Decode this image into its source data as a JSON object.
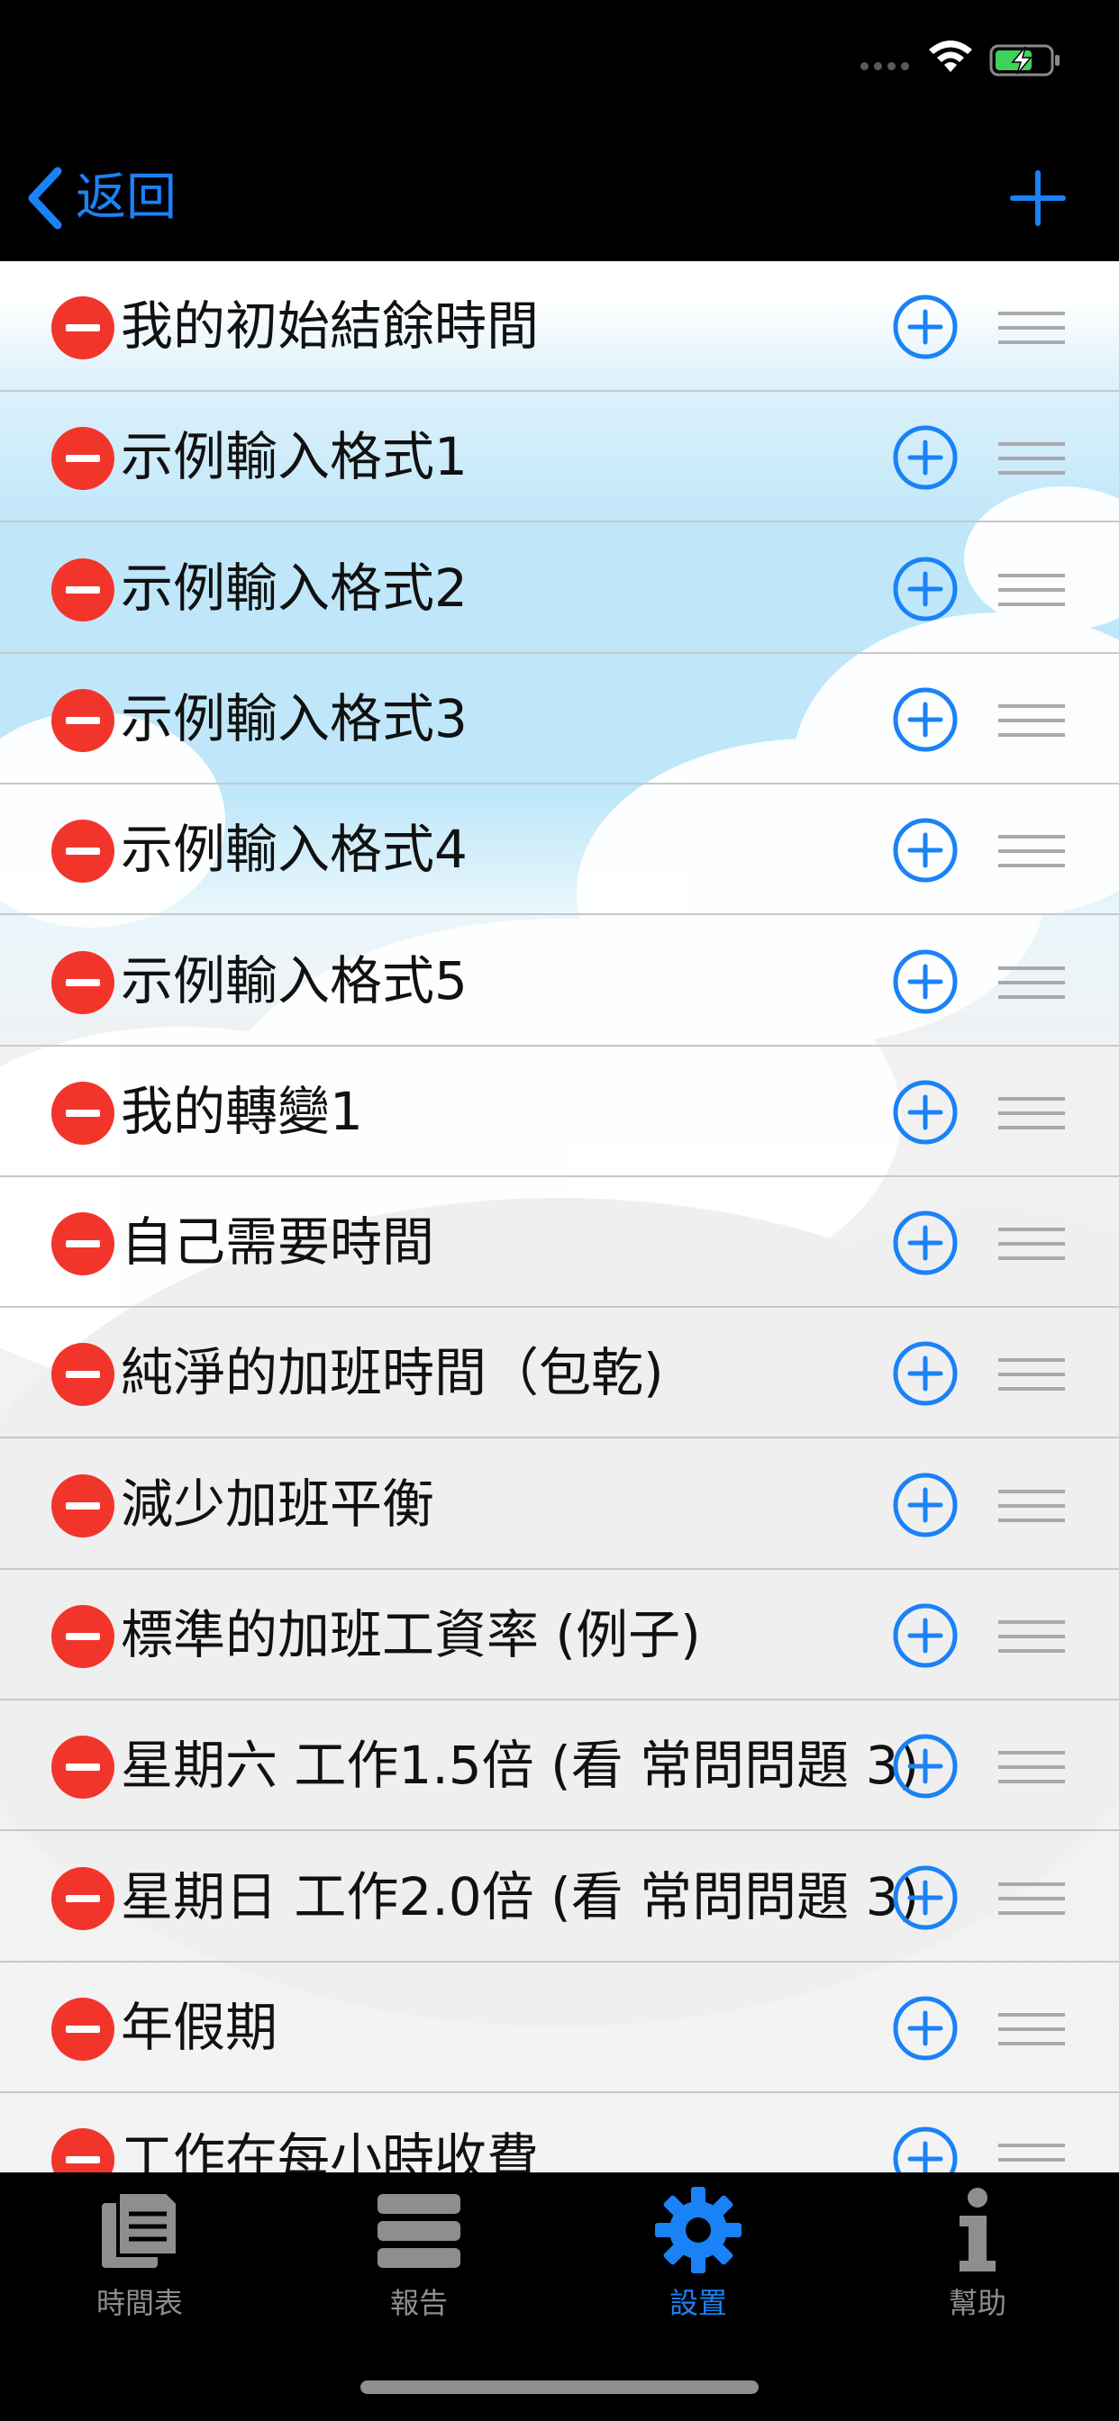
{
  "nav": {
    "back_label": "返回"
  },
  "list": {
    "items": [
      {
        "label": "我的初始結餘時間"
      },
      {
        "label": "示例輸入格式1"
      },
      {
        "label": "示例輸入格式2"
      },
      {
        "label": "示例輸入格式3"
      },
      {
        "label": "示例輸入格式4"
      },
      {
        "label": "示例輸入格式5"
      },
      {
        "label": "我的轉變1"
      },
      {
        "label": "自己需要時間"
      },
      {
        "label": "純淨的加班時間（包乾)"
      },
      {
        "label": "減少加班平衡"
      },
      {
        "label": "標準的加班工資率 (例子)"
      },
      {
        "label": "星期六 工作1.5倍 (看 常問問題 3)"
      },
      {
        "label": "星期日 工作2.0倍 (看 常問問題 3)"
      },
      {
        "label": "年假期"
      },
      {
        "label": "工作在每小時收費"
      }
    ]
  },
  "tabs": [
    {
      "label": "時間表",
      "icon": "document-icon",
      "active": false
    },
    {
      "label": "報告",
      "icon": "list-icon",
      "active": false
    },
    {
      "label": "設置",
      "icon": "gear-icon",
      "active": true
    },
    {
      "label": "幫助",
      "icon": "info-icon",
      "active": false
    }
  ],
  "colors": {
    "accent": "#1a82f7",
    "delete": "#f2352b",
    "tab_inactive": "#8e8e8e"
  }
}
